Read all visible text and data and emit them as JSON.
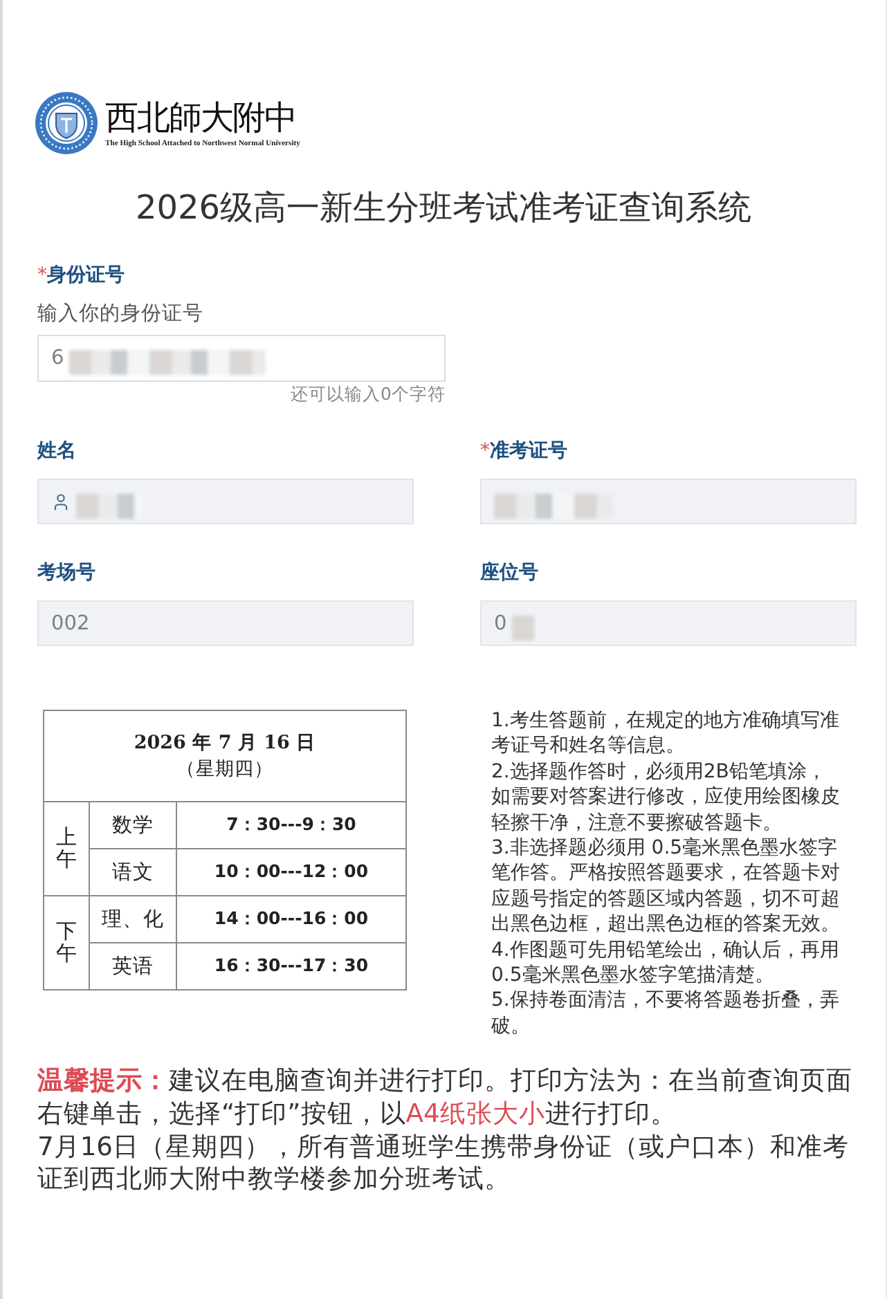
{
  "header": {
    "wordmark": "西北師大附中",
    "subtitle": "The High School Attached to Northwest Normal University"
  },
  "title": "2026级高一新生分班考试准考证查询系统",
  "id_field": {
    "required_mark": "*",
    "label": "身份证号",
    "hint": "输入你的身份证号",
    "value": "6",
    "redacted": true,
    "disabled": false,
    "counter": "还可以输入0个字符"
  },
  "fields": [
    {
      "label": "姓名",
      "kind": "person",
      "redacted": true,
      "disabled": true
    },
    {
      "required_mark": "*",
      "label": "准考证号",
      "kind": "plain",
      "redacted": true,
      "disabled": true
    },
    {
      "label": "考场号",
      "kind": "plain",
      "value": "002",
      "disabled": true
    },
    {
      "label": "座位号",
      "kind": "plain",
      "value": "0",
      "redacted": true,
      "disabled": true
    }
  ],
  "schedule": {
    "date": "2026 年 7 月 16 日",
    "weekday": "（星期四）",
    "periods": [
      {
        "name": "上午",
        "sessions": [
          {
            "subject": "数学",
            "time": "7：30---9：30"
          },
          {
            "subject": "语文",
            "time": "10：00---12：00"
          }
        ]
      },
      {
        "name": "下午",
        "sessions": [
          {
            "subject": "理、化",
            "time": "14：00---16：00"
          },
          {
            "subject": "英语",
            "time": "16：30---17：30"
          }
        ]
      }
    ]
  },
  "notes": [
    "1.考生答题前，在规定的地方准确填写准考证号和姓名等信息。",
    "2.选择题作答时，必须用2B铅笔填涂，如需要对答案进行修改，应使用绘图橡皮轻擦干净，注意不要擦破答题卡。",
    "3.非选择题必须用 0.5毫米黑色墨水签字笔作答。严格按照答题要求，在答题卡对应题号指定的答题区域内答题，切不可超出黑色边框，超出黑色边框的答案无效。",
    "4.作图题可先用铅笔绘出，确认后，再用0.5毫米黑色墨水签字笔描清楚。",
    "5.保持卷面清洁，不要将答题卷折叠，弄破。"
  ],
  "tip": {
    "segments": [
      {
        "kind": "label",
        "text": "温馨提示："
      },
      {
        "kind": "plain",
        "text": "建议在电脑查询并进行打印。打印方法为：在当前查询页面右键单击，选择“打印”按钮，以"
      },
      {
        "kind": "highlight",
        "text": "A4纸张大小"
      },
      {
        "kind": "plain",
        "text": "进行打印。"
      }
    ]
  },
  "notice": "7月16日（星期四），所有普通班学生携带身份证（或户口本）和准考证到西北师大附中教学楼参加分班考试。"
}
